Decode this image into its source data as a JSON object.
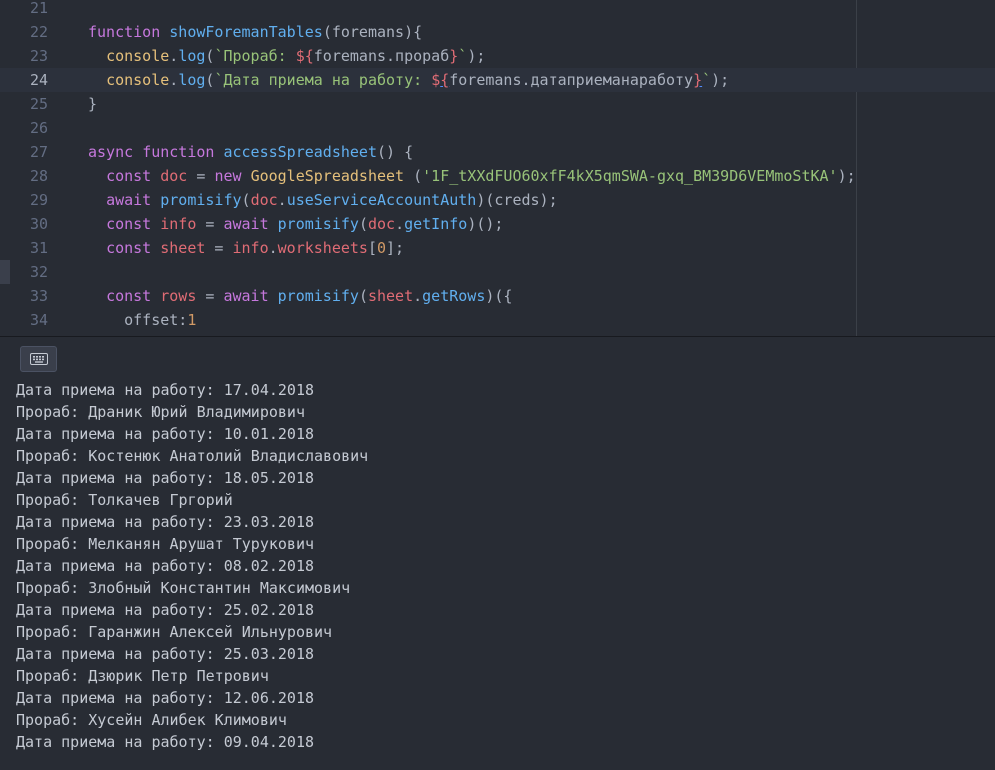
{
  "editor": {
    "active_line": "24",
    "lines": [
      {
        "no": "21",
        "tokens": []
      },
      {
        "no": "22",
        "tokens": [
          {
            "t": "function ",
            "c": "kw"
          },
          {
            "t": "showForemanTables",
            "c": "fn"
          },
          {
            "t": "(foremans){",
            "c": "plain"
          }
        ]
      },
      {
        "no": "23",
        "tokens": [
          {
            "t": "  ",
            "c": "plain"
          },
          {
            "t": "console",
            "c": "class"
          },
          {
            "t": ".",
            "c": "plain"
          },
          {
            "t": "log",
            "c": "fn"
          },
          {
            "t": "(",
            "c": "plain"
          },
          {
            "t": "`Прораб: ",
            "c": "str"
          },
          {
            "t": "${",
            "c": "var"
          },
          {
            "t": "foremans.прораб",
            "c": "plain"
          },
          {
            "t": "}",
            "c": "var"
          },
          {
            "t": "`",
            "c": "str"
          },
          {
            "t": ");",
            "c": "plain"
          }
        ]
      },
      {
        "no": "24",
        "tokens": [
          {
            "t": "  ",
            "c": "plain"
          },
          {
            "t": "console",
            "c": "class"
          },
          {
            "t": ".",
            "c": "plain"
          },
          {
            "t": "log",
            "c": "fn"
          },
          {
            "t": "(",
            "c": "plain"
          },
          {
            "t": "`Дата приема на работу: ",
            "c": "str"
          },
          {
            "t": "$",
            "c": "var"
          },
          {
            "t": "{",
            "c": "var-under"
          },
          {
            "t": "foremans.датаприеманаработу",
            "c": "plain"
          },
          {
            "t": "}",
            "c": "var-under"
          },
          {
            "t": "`",
            "c": "str"
          },
          {
            "t": ");",
            "c": "plain"
          }
        ]
      },
      {
        "no": "25",
        "tokens": [
          {
            "t": "}",
            "c": "plain"
          }
        ]
      },
      {
        "no": "26",
        "tokens": []
      },
      {
        "no": "27",
        "tokens": [
          {
            "t": "async ",
            "c": "kw"
          },
          {
            "t": "function ",
            "c": "kw"
          },
          {
            "t": "accessSpreadsheet",
            "c": "fn"
          },
          {
            "t": "() {",
            "c": "plain"
          }
        ]
      },
      {
        "no": "28",
        "tokens": [
          {
            "t": "  ",
            "c": "plain"
          },
          {
            "t": "const ",
            "c": "kw"
          },
          {
            "t": "doc",
            "c": "var"
          },
          {
            "t": " = ",
            "c": "plain"
          },
          {
            "t": "new ",
            "c": "kw"
          },
          {
            "t": "GoogleSpreadsheet",
            "c": "class"
          },
          {
            "t": " (",
            "c": "plain"
          },
          {
            "t": "'1F_tXXdFUO60xfF4kX5qmSWA-gxq_BM39D6VEMmoStKA'",
            "c": "str"
          },
          {
            "t": ");",
            "c": "plain"
          }
        ]
      },
      {
        "no": "29",
        "tokens": [
          {
            "t": "  ",
            "c": "plain"
          },
          {
            "t": "await ",
            "c": "kw"
          },
          {
            "t": "promisify",
            "c": "fn"
          },
          {
            "t": "(",
            "c": "plain"
          },
          {
            "t": "doc",
            "c": "var"
          },
          {
            "t": ".",
            "c": "plain"
          },
          {
            "t": "useServiceAccountAuth",
            "c": "fn"
          },
          {
            "t": ")(creds);",
            "c": "plain"
          }
        ]
      },
      {
        "no": "30",
        "tokens": [
          {
            "t": "  ",
            "c": "plain"
          },
          {
            "t": "const ",
            "c": "kw"
          },
          {
            "t": "info",
            "c": "var"
          },
          {
            "t": " = ",
            "c": "plain"
          },
          {
            "t": "await ",
            "c": "kw"
          },
          {
            "t": "promisify",
            "c": "fn"
          },
          {
            "t": "(",
            "c": "plain"
          },
          {
            "t": "doc",
            "c": "var"
          },
          {
            "t": ".",
            "c": "plain"
          },
          {
            "t": "getInfo",
            "c": "fn"
          },
          {
            "t": ")();",
            "c": "plain"
          }
        ]
      },
      {
        "no": "31",
        "tokens": [
          {
            "t": "  ",
            "c": "plain"
          },
          {
            "t": "const ",
            "c": "kw"
          },
          {
            "t": "sheet",
            "c": "var"
          },
          {
            "t": " = ",
            "c": "plain"
          },
          {
            "t": "info",
            "c": "var"
          },
          {
            "t": ".",
            "c": "plain"
          },
          {
            "t": "worksheets",
            "c": "var"
          },
          {
            "t": "[",
            "c": "plain"
          },
          {
            "t": "0",
            "c": "num"
          },
          {
            "t": "];",
            "c": "plain"
          }
        ]
      },
      {
        "no": "32",
        "tokens": []
      },
      {
        "no": "33",
        "tokens": [
          {
            "t": "  ",
            "c": "plain"
          },
          {
            "t": "const ",
            "c": "kw"
          },
          {
            "t": "rows",
            "c": "var"
          },
          {
            "t": " = ",
            "c": "plain"
          },
          {
            "t": "await ",
            "c": "kw"
          },
          {
            "t": "promisify",
            "c": "fn"
          },
          {
            "t": "(",
            "c": "plain"
          },
          {
            "t": "sheet",
            "c": "var"
          },
          {
            "t": ".",
            "c": "plain"
          },
          {
            "t": "getRows",
            "c": "fn"
          },
          {
            "t": ")({",
            "c": "plain"
          }
        ]
      },
      {
        "no": "34",
        "tokens": [
          {
            "t": "    offset:",
            "c": "plain"
          },
          {
            "t": "1",
            "c": "num"
          }
        ]
      }
    ]
  },
  "console": {
    "toggle_icon": "keyboard-icon",
    "output": [
      "Дата приема на работу: 17.04.2018",
      "Прораб: Драник Юрий Владимирович",
      "Дата приема на работу: 10.01.2018",
      "Прораб: Костенюк Анатолий Владиславович",
      "Дата приема на работу: 18.05.2018",
      "Прораб: Толкачев Гргорий",
      "Дата приема на работу: 23.03.2018",
      "Прораб: Мелканян Арушат Турукович",
      "Дата приема на работу: 08.02.2018",
      "Прораб: Злобный Константин Максимович",
      "Дата приема на работу: 25.02.2018",
      "Прораб: Гаранжин Алексей Ильнурович",
      "Дата приема на работу: 25.03.2018",
      "Прораб: Дзюрик Петр Петрович",
      "Дата приема на работу: 12.06.2018",
      "Прораб: Хусейн Алибек Климович",
      "Дата приема на работу: 09.04.2018"
    ]
  },
  "colors": {
    "background": "#282c34",
    "keyword": "#c678dd",
    "function": "#61afef",
    "variable": "#e06c75",
    "string": "#98c379",
    "number": "#d19a66",
    "class": "#e5c07b",
    "plain": "#abb2bf"
  }
}
